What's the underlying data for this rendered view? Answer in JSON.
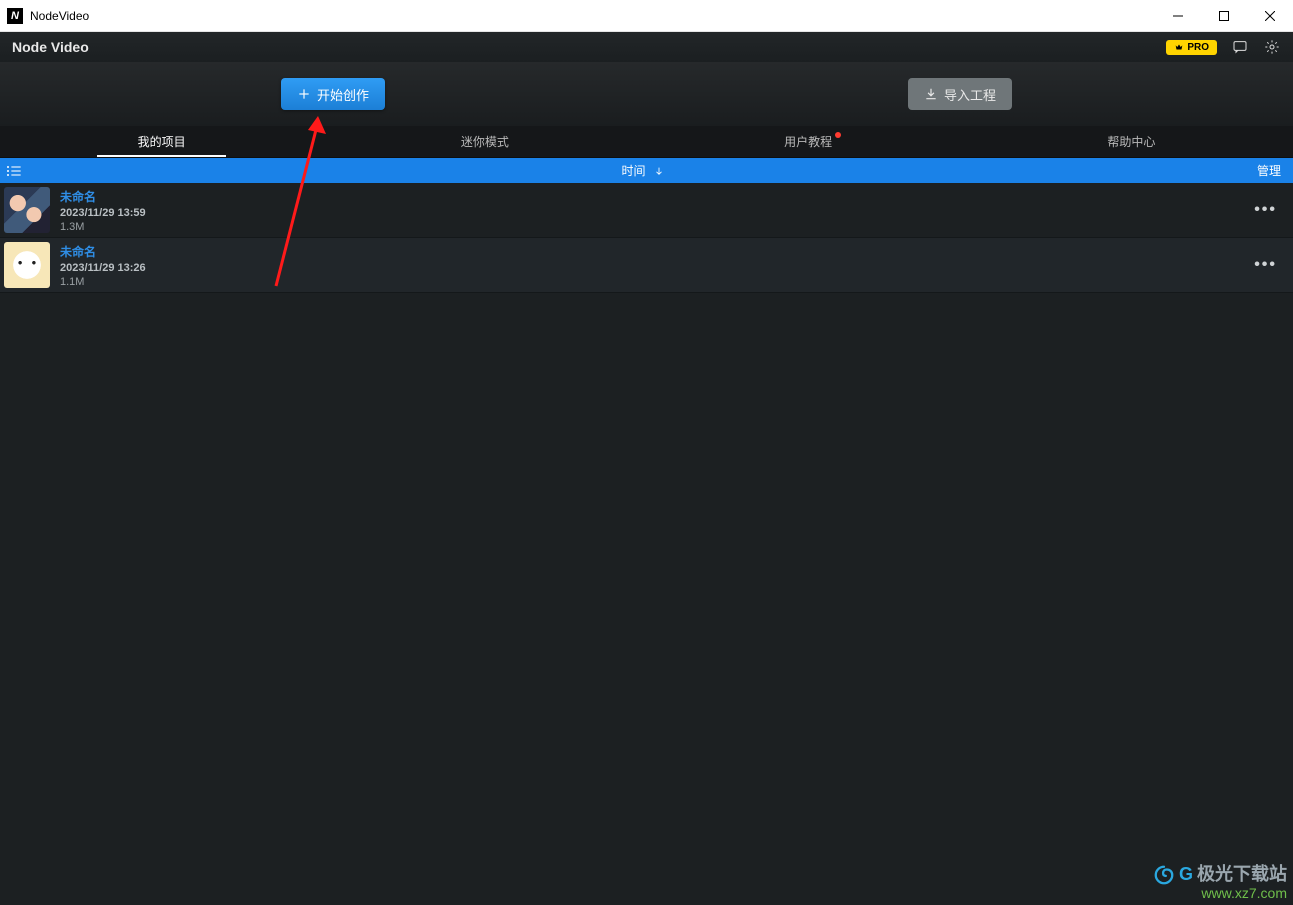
{
  "window": {
    "title": "NodeVideo"
  },
  "header": {
    "brand": "Node Video",
    "pro": "PRO"
  },
  "actions": {
    "create": "开始创作",
    "import": "导入工程"
  },
  "tabs": {
    "my_projects": "我的项目",
    "mini_mode": "迷你模式",
    "tutorials": "用户教程",
    "help": "帮助中心"
  },
  "sortbar": {
    "sort_label": "时间",
    "manage": "管理"
  },
  "projects": [
    {
      "name": "未命名",
      "date": "2023/11/29 13:59",
      "size": "1.3M"
    },
    {
      "name": "未命名",
      "date": "2023/11/29 13:26",
      "size": "1.1M"
    }
  ],
  "watermark": {
    "brand_g": "G",
    "brand_rest": "极光下载站",
    "url": "www.xz7.com"
  }
}
